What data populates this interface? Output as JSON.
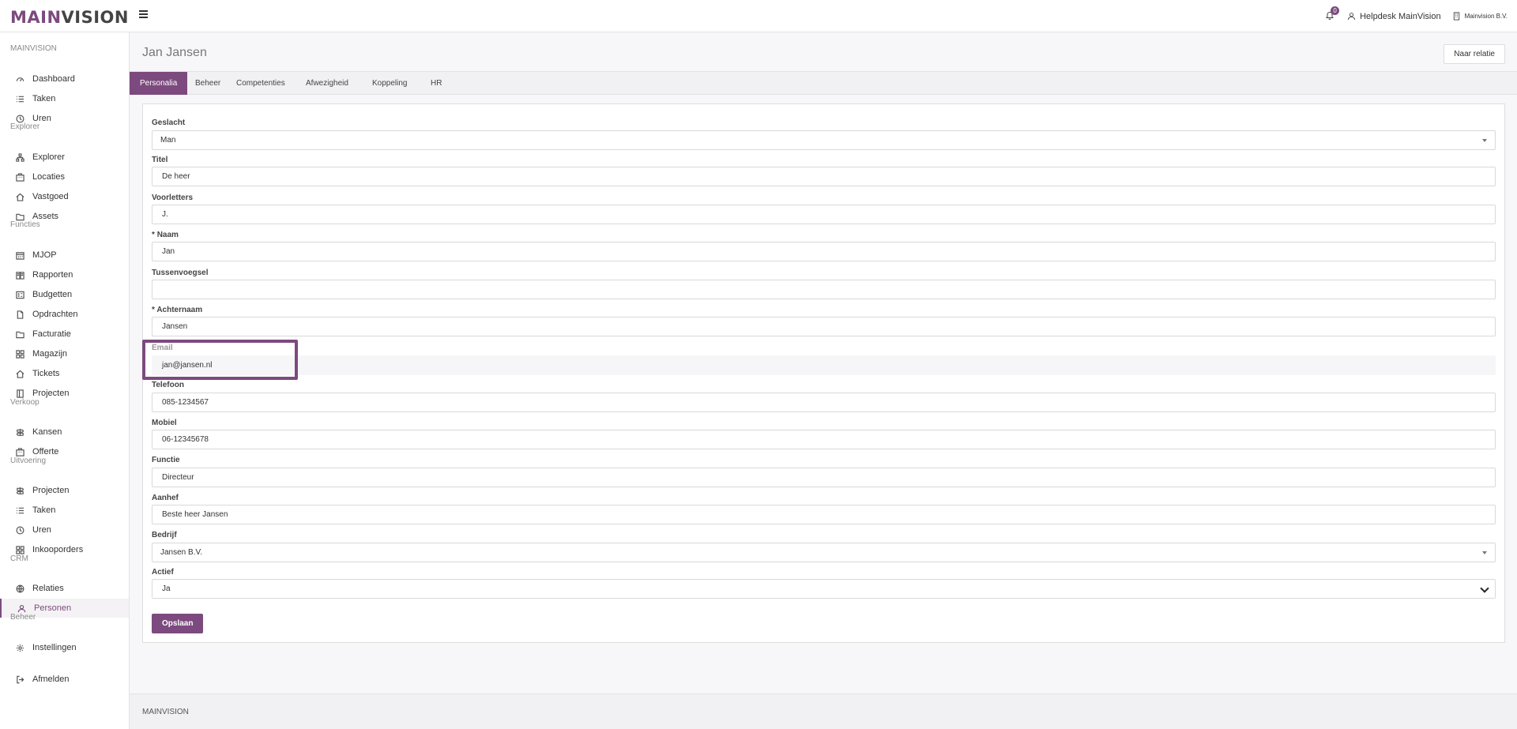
{
  "topbar": {
    "logo_part1": "MAIN",
    "logo_part2": "VISION",
    "notification_count": "0",
    "user": "Helpdesk MainVision",
    "company": "Mainvision B.V."
  },
  "sidebar": {
    "sections": [
      "MAINVISION",
      "Explorer",
      "Functies",
      "Verkoop",
      "Uitvoering",
      "CRM",
      "Beheer"
    ],
    "items": [
      {
        "label": "Dashboard",
        "icon": "dashboard-icon"
      },
      {
        "label": "Taken",
        "icon": "list-icon"
      },
      {
        "label": "Uren",
        "icon": "clock-icon"
      },
      {
        "label": "Explorer",
        "icon": "sitemap-icon"
      },
      {
        "label": "Locaties",
        "icon": "building-icon"
      },
      {
        "label": "Vastgoed",
        "icon": "home-icon"
      },
      {
        "label": "Assets",
        "icon": "folder-icon"
      },
      {
        "label": "MJOP",
        "icon": "calendar-icon"
      },
      {
        "label": "Rapporten",
        "icon": "book-icon"
      },
      {
        "label": "Budgetten",
        "icon": "budget-icon"
      },
      {
        "label": "Opdrachten",
        "icon": "file-icon"
      },
      {
        "label": "Facturatie",
        "icon": "folder-icon"
      },
      {
        "label": "Magazijn",
        "icon": "grid-icon"
      },
      {
        "label": "Tickets",
        "icon": "home-icon"
      },
      {
        "label": "Projecten",
        "icon": "door-icon"
      },
      {
        "label": "Kansen",
        "icon": "signpost-icon"
      },
      {
        "label": "Offerte",
        "icon": "building-icon"
      },
      {
        "label": "Projecten",
        "icon": "signpost-icon"
      },
      {
        "label": "Taken",
        "icon": "list-icon"
      },
      {
        "label": "Uren",
        "icon": "clock-icon"
      },
      {
        "label": "Inkooporders",
        "icon": "grid-icon"
      },
      {
        "label": "Relaties",
        "icon": "globe-icon"
      },
      {
        "label": "Personen",
        "icon": "user-icon"
      },
      {
        "label": "Instellingen",
        "icon": "gear-icon"
      },
      {
        "label": "Afmelden",
        "icon": "logout-icon"
      }
    ]
  },
  "page": {
    "title": "Jan Jansen",
    "naar_relatie": "Naar relatie",
    "tabs": [
      "Personalia",
      "Beheer",
      "Competenties",
      "Afwezigheid",
      "Koppeling",
      "HR"
    ],
    "active_tab": "Personalia"
  },
  "form": {
    "geslacht": {
      "label": "Geslacht",
      "value": "Man"
    },
    "titel": {
      "label": "Titel",
      "value": "De heer"
    },
    "voorletters": {
      "label": "Voorletters",
      "value": "J."
    },
    "naam": {
      "label": "Naam",
      "value": "Jan"
    },
    "tussenvoegsel": {
      "label": "Tussenvoegsel",
      "value": ""
    },
    "achternaam": {
      "label": "Achternaam",
      "value": "Jansen"
    },
    "email": {
      "label": "Email",
      "value": "jan@jansen.nl"
    },
    "telefoon": {
      "label": "Telefoon",
      "value": "085-1234567"
    },
    "mobiel": {
      "label": "Mobiel",
      "value": "06-12345678"
    },
    "functie": {
      "label": "Functie",
      "value": "Directeur"
    },
    "aanhef": {
      "label": "Aanhef",
      "value": "Beste heer Jansen"
    },
    "bedrijf": {
      "label": "Bedrijf",
      "value": "Jansen B.V."
    },
    "actief": {
      "label": "Actief",
      "value": "Ja"
    },
    "required_marker": "*",
    "save": "Opslaan"
  },
  "footer": {
    "text": "MAINVISION"
  },
  "colors": {
    "accent": "#7c4a7e"
  }
}
